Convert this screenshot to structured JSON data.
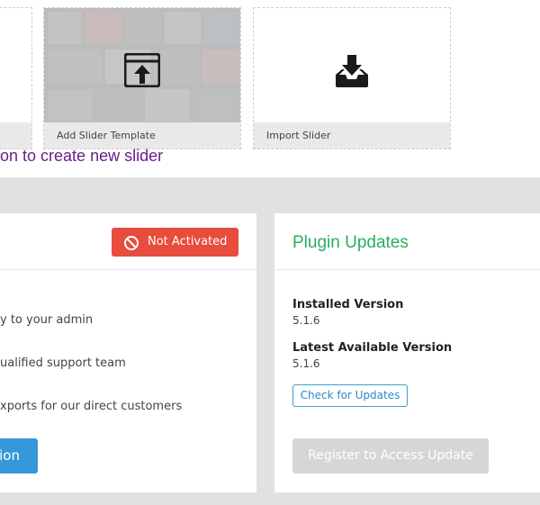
{
  "tiles": {
    "template_label": "Add Slider Template",
    "import_label": "Import Slider",
    "template_icon": "window-upload-icon",
    "import_icon": "tray-download-icon"
  },
  "hint_text": "on to create new slider",
  "activation": {
    "status_label": "Not Activated",
    "status_icon": "ban-icon",
    "status_color": "#e74c3c",
    "benefits": [
      "y to your admin",
      "ualified support team",
      "xports for our direct customers"
    ],
    "activate_label": "ion",
    "activate_color": "#3498db"
  },
  "updates": {
    "title": "Plugin Updates",
    "title_color": "#27ae60",
    "installed_label": "Installed Version",
    "installed_value": "5.1.6",
    "latest_label": "Latest Available Version",
    "latest_value": "5.1.6",
    "check_label": "Check for Updates",
    "register_label": "Register to Access Update"
  }
}
